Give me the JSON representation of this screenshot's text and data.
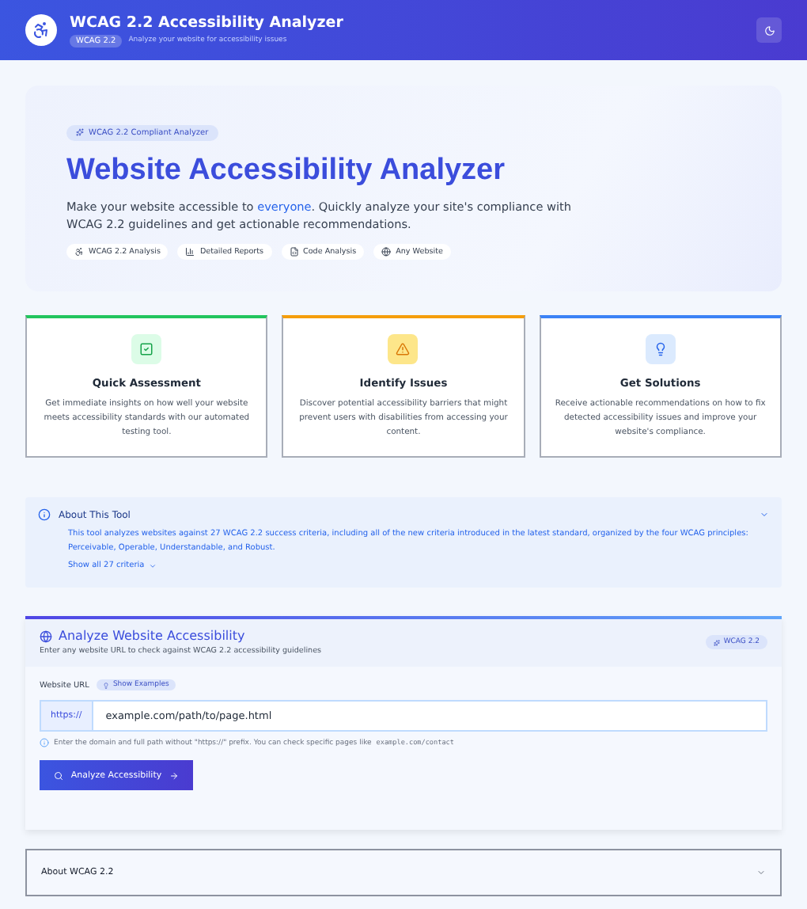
{
  "header": {
    "title": "WCAG 2.2 Accessibility Analyzer",
    "badge": "WCAG 2.2",
    "subtitle": "Analyze your website for accessibility issues"
  },
  "hero": {
    "badge": "WCAG 2.2 Compliant Analyzer",
    "title": "Website Accessibility Analyzer",
    "description": "Make your website accessible to **everyone**. Quickly analyze your site's compliance with WCAG 2.2 guidelines and get actionable recommendations.",
    "features": [
      {
        "kind": "access",
        "label": "WCAG 2.2 Analysis"
      },
      {
        "kind": "chart",
        "label": "Detailed Reports"
      },
      {
        "kind": "code",
        "label": "Code Analysis"
      },
      {
        "kind": "globe",
        "label": "Any Website"
      }
    ]
  },
  "cards": [
    {
      "kind": "check",
      "color": "#22c55e",
      "title": "Quick Assessment",
      "text": "Get immediate insights on how well your website meets accessibility standards with our automated testing tool."
    },
    {
      "kind": "warning",
      "color": "#f59e0b",
      "title": "Identify Issues",
      "text": "Discover potential accessibility barriers that might prevent users with disabilities from accessing your content."
    },
    {
      "kind": "bulb",
      "color": "#3b82f6",
      "title": "Get Solutions",
      "text": "Receive actionable recommendations on how to fix detected accessibility issues and improve your website's compliance."
    }
  ],
  "about_tool": {
    "title": "About This Tool",
    "text": "This tool analyzes websites against 27 WCAG 2.2 success criteria, including all of the new criteria introduced in the latest standard, organized by the four WCAG principles: Perceivable, Operable, Understandable, and Robust.",
    "link": "Show all 27 criteria"
  },
  "analyze": {
    "title": "Analyze Website Accessibility",
    "subtitle": "Enter any website URL to check against WCAG 2.2 accessibility guidelines",
    "badge": "WCAG 2.2",
    "label": "Website URL",
    "examples": "Show Examples",
    "prefix": "https://",
    "value": "example.com/path/to/page.html",
    "hint": "Enter the domain and full path without \"https://\" prefix. You can check specific pages like",
    "hint_code": "example.com/contact",
    "button": "Analyze Accessibility"
  },
  "about_wcag": {
    "title": "About WCAG 2.2"
  }
}
